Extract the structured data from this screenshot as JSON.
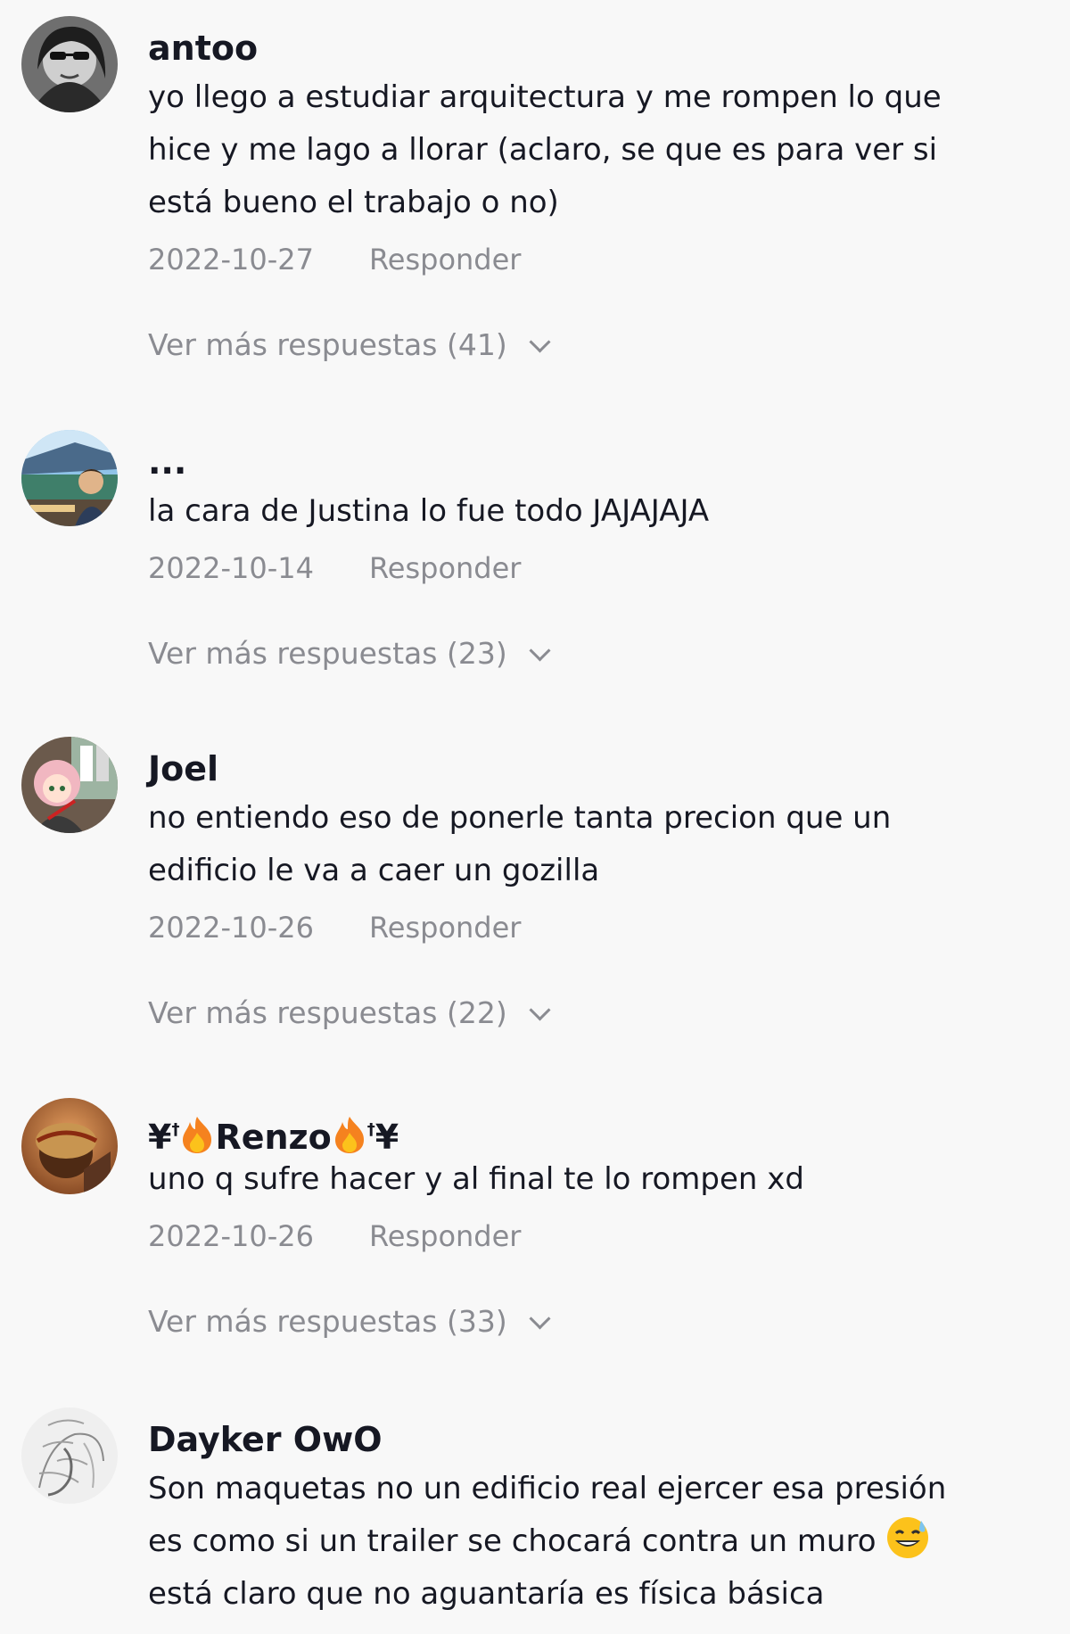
{
  "comments": [
    {
      "username": "antoo",
      "text": "yo llego a estudiar arquitectura y me rompen lo que\nhice y me lago a llorar (aclaro, se que es para ver si\nestá bueno el trabajo o no)",
      "date": "2022-10-27",
      "reply_label": "Responder",
      "more_replies": "Ver más respuestas (41)"
    },
    {
      "username": "...",
      "text": "la cara de Justina lo fue todo JAJAJAJA",
      "date": "2022-10-14",
      "reply_label": "Responder",
      "more_replies": "Ver más respuestas (23)"
    },
    {
      "username": "Joel",
      "text": "no entiendo eso de ponerle tanta precion que un\nedificio le va a caer un gozilla",
      "date": "2022-10-26",
      "reply_label": "Responder",
      "more_replies": "Ver más respuestas (22)"
    },
    {
      "username_parts": {
        "left": "¥",
        "dagger": "†",
        "name": "Renzo",
        "right": "¥"
      },
      "text": "uno q sufre hacer y al final te lo rompen xd",
      "date": "2022-10-26",
      "reply_label": "Responder",
      "more_replies": "Ver más respuestas (33)"
    },
    {
      "username": "Dayker OwO",
      "text_line1": "Son maquetas no un edificio real ejercer esa presión",
      "text_line2": "es como si un trailer se chocará contra un muro ",
      "text_line3": "está claro que no aguantaría es física básica"
    }
  ],
  "icons": {
    "flame": "fire-emoji",
    "sweat": "grinning-sweat-emoji",
    "chevron": "chevron-down-icon"
  }
}
